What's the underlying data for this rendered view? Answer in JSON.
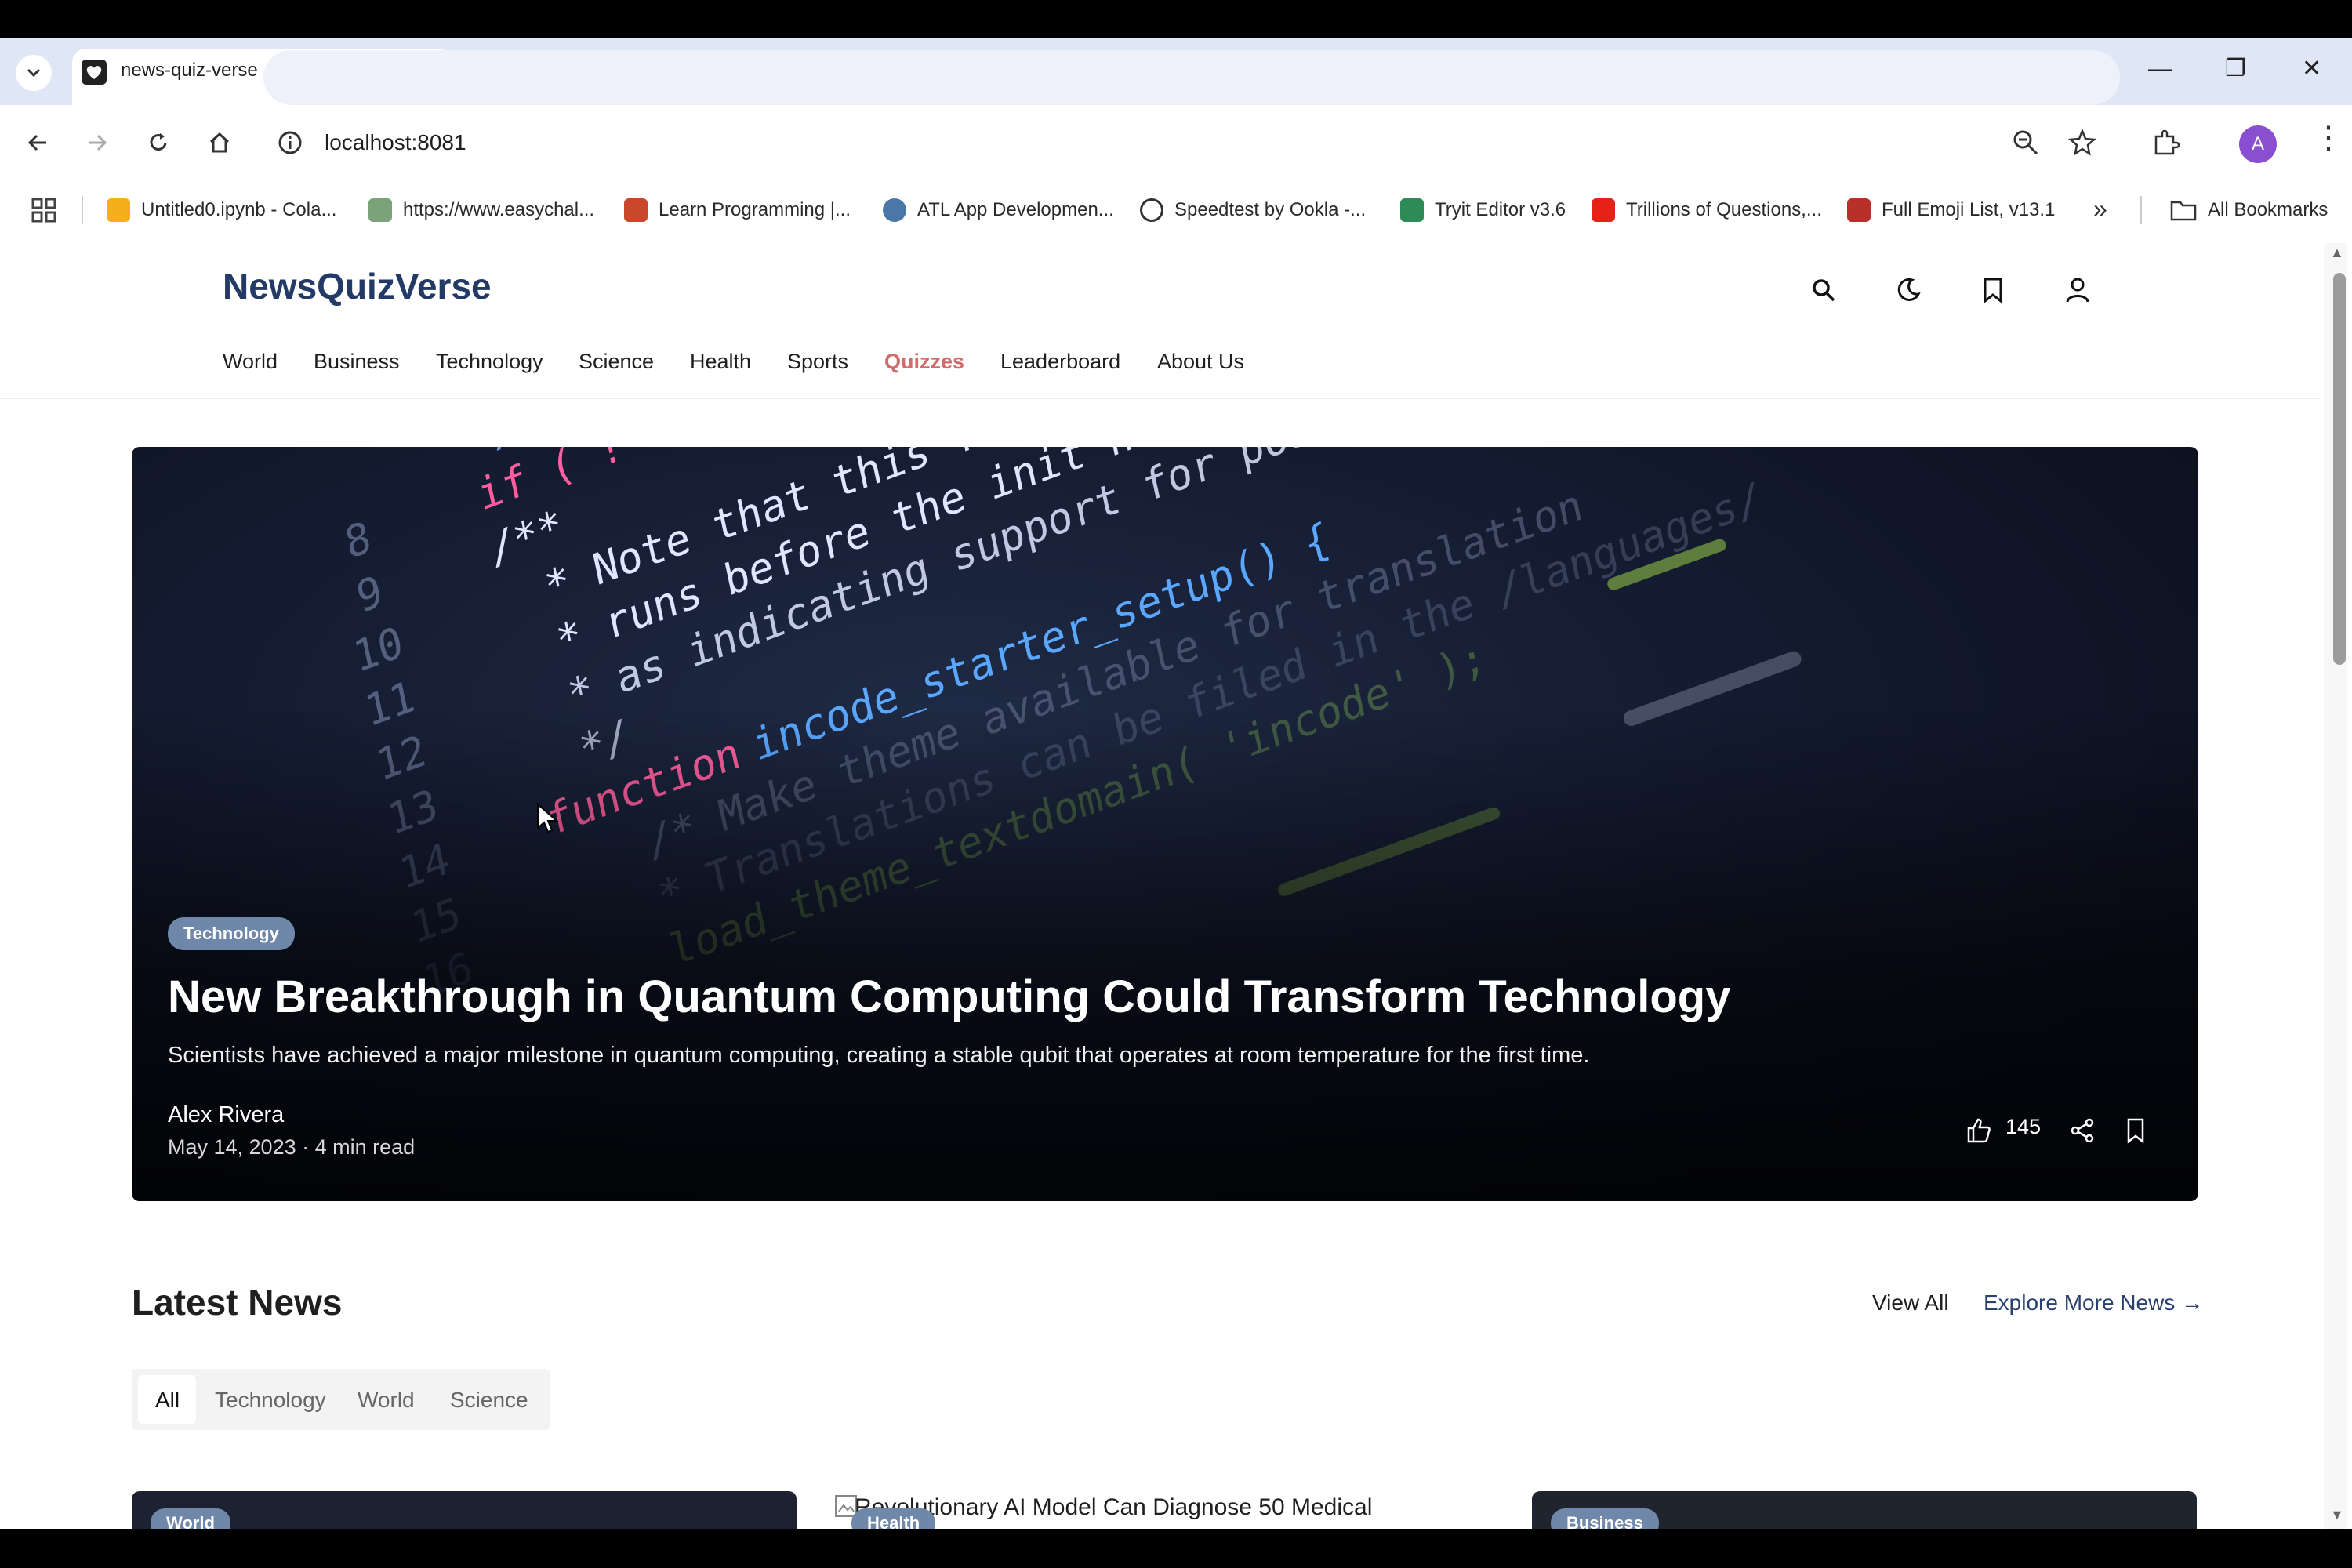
{
  "browser": {
    "tab_title": "news-quiz-verse",
    "url": "localhost:8081",
    "profile_initial": "A",
    "bookmarks": [
      {
        "label": "Untitled0.ipynb - Cola...",
        "icon": "colab-icon"
      },
      {
        "label": "https://www.easychal...",
        "icon": "easychallenge-icon"
      },
      {
        "label": "Learn Programming |...",
        "icon": "codecademy-icon"
      },
      {
        "label": "ATL App Developmen...",
        "icon": "atl-icon"
      },
      {
        "label": "Speedtest by Ookla -...",
        "icon": "speedtest-icon"
      },
      {
        "label": "Tryit Editor v3.6",
        "icon": "w3schools-icon"
      },
      {
        "label": "Trillions of Questions,...",
        "icon": "youtube-icon"
      },
      {
        "label": "Full Emoji List, v13.1",
        "icon": "unicode-icon"
      }
    ],
    "all_bookmarks": "All Bookmarks"
  },
  "site": {
    "logo": "NewsQuizVerse",
    "nav": [
      "World",
      "Business",
      "Technology",
      "Science",
      "Health",
      "Sports",
      "Quizzes",
      "Leaderboard",
      "About Us"
    ],
    "active_nav": "Quizzes"
  },
  "hero": {
    "badge": "Technology",
    "title": "New Breakthrough in Quantum Computing Could Transform Technology",
    "description": "Scientists have achieved a major milestone in quantum computing, creating a stable qubit that operates at room temperature for the first time.",
    "author": "Alex Rivera",
    "meta": "May 14, 2023 · 4 min read",
    "likes": "145"
  },
  "latest": {
    "title": "Latest News",
    "view_all": "View All",
    "explore": "Explore More News",
    "filters": [
      "All",
      "Technology",
      "World",
      "Science"
    ],
    "active_filter": "All",
    "cards": [
      {
        "badge": "World"
      },
      {
        "badge": "Health",
        "alt": "Revolutionary AI Model Can Diagnose 50 Medical"
      },
      {
        "badge": "Business"
      }
    ]
  },
  "colors": {
    "brand": "#233a67",
    "accent_active_nav": "#d26b6b",
    "badge": "#6f87a9"
  }
}
